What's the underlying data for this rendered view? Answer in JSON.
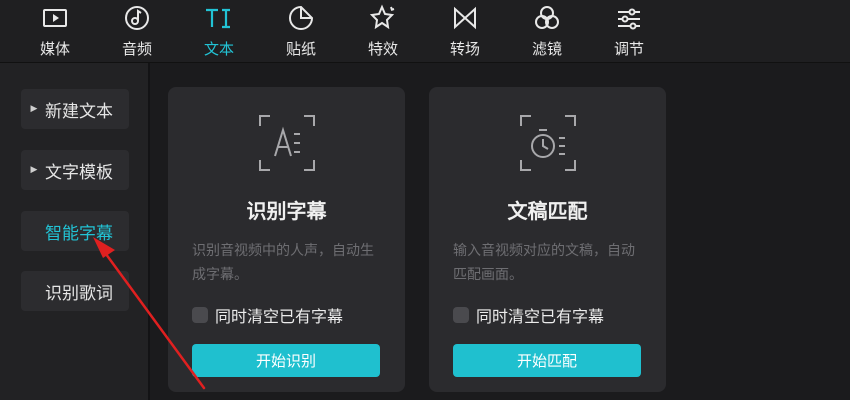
{
  "toolbar": {
    "tabs": [
      {
        "label": "媒体",
        "icon": "media-icon"
      },
      {
        "label": "音频",
        "icon": "audio-icon"
      },
      {
        "label": "文本",
        "icon": "text-icon"
      },
      {
        "label": "贴纸",
        "icon": "sticker-icon"
      },
      {
        "label": "特效",
        "icon": "effects-icon"
      },
      {
        "label": "转场",
        "icon": "transition-icon"
      },
      {
        "label": "滤镜",
        "icon": "filter-icon"
      },
      {
        "label": "调节",
        "icon": "adjust-icon"
      }
    ],
    "active_tab": "文本"
  },
  "sidebar": {
    "items": [
      {
        "label": "新建文本"
      },
      {
        "label": "文字模板"
      },
      {
        "label": "智能字幕"
      },
      {
        "label": "识别歌词"
      }
    ],
    "active_item": "智能字幕"
  },
  "cards": [
    {
      "icon": "recognize-subtitle-icon",
      "title": "识别字幕",
      "description": "识别音视频中的人声，自动生成字幕。",
      "checkbox_label": "同时清空已有字幕",
      "button_label": "开始识别"
    },
    {
      "icon": "script-match-icon",
      "title": "文稿匹配",
      "description": "输入音视频对应的文稿，自动匹配画面。",
      "checkbox_label": "同时清空已有字幕",
      "button_label": "开始匹配"
    }
  ],
  "colors": {
    "accent": "#22c3d5",
    "button": "#1fc0cf",
    "annotation_arrow": "#e02020"
  }
}
